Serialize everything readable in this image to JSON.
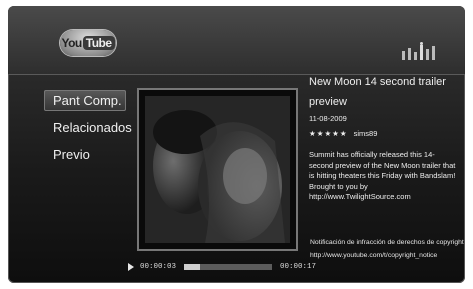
{
  "header": {
    "logo": "YouTube",
    "logo_parts": [
      "You",
      "Tube"
    ],
    "signal_icon": "signal-strength-icon"
  },
  "menu": {
    "items": [
      {
        "label": "Pant Comp.",
        "selected": true
      },
      {
        "label": "Relacionados",
        "selected": false
      },
      {
        "label": "Previo",
        "selected": false
      }
    ]
  },
  "player": {
    "elapsed": "00:00:03",
    "duration": "00:00:17",
    "progress_fraction": 0.18
  },
  "video_info": {
    "title": "New Moon 14 second trailer",
    "title_line2": "preview",
    "date": "11-08-2009",
    "stars": "★★★★★",
    "user": "sims89",
    "description": "Summit has officially released this 14-second preview of the New Moon trailer that is hitting theaters this Friday with Bandslam! Brought to you by http://www.TwilightSource.com"
  },
  "footer": {
    "copyright_notice": "Notificación de infracción de derechos de copyright",
    "copyright_url": "http://www.youtube.com/t/copyright_notice"
  },
  "colors": {
    "background_top": "#3c3c3c",
    "background_bottom": "#0e0e0e",
    "text": "#eeeeee",
    "selected_bg": "#4a4a4a"
  }
}
